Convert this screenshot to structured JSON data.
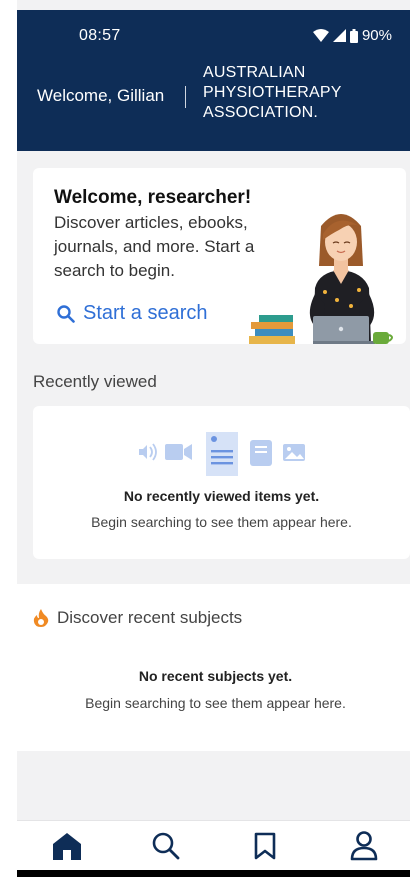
{
  "status_bar": {
    "time": "08:57",
    "battery": "90%"
  },
  "header": {
    "welcome": "Welcome, Gillian",
    "brand_lines": [
      "AUSTRALIAN",
      "PHYSIOTHERAPY",
      "ASSOCIATION."
    ]
  },
  "hero": {
    "title": "Welcome, researcher!",
    "text": "Discover articles, ebooks, journals, and more. Start a search to begin.",
    "search_label": "Start a search"
  },
  "recently_viewed": {
    "title": "Recently viewed",
    "empty_title": "No recently viewed items yet.",
    "empty_sub": "Begin searching to see them appear here."
  },
  "discover": {
    "title": "Discover recent subjects",
    "empty_title": "No recent subjects yet.",
    "empty_sub": "Begin searching to see them appear here."
  },
  "nav": {
    "items": [
      "home-icon",
      "search-icon",
      "bookmark-icon",
      "profile-icon"
    ],
    "active": "home-icon"
  },
  "colors": {
    "header_bg": "#0e2d57",
    "accent_blue": "#2f6fd6",
    "nav_icon": "#0e2d57",
    "fire_orange": "#f08a24"
  }
}
